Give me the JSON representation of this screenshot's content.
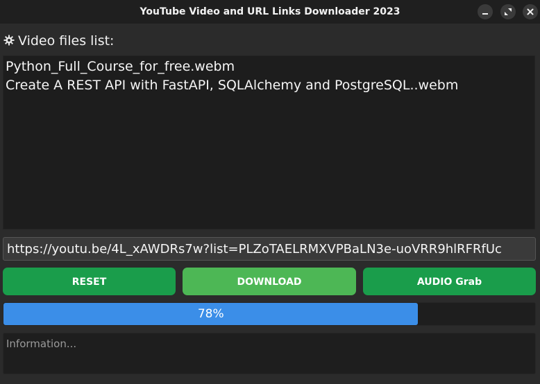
{
  "window": {
    "title": "YouTube Video and URL Links Downloader 2023",
    "controls": [
      "minimize-icon",
      "maximize-icon",
      "close-icon"
    ]
  },
  "file_list": {
    "label": "Video files list:",
    "icon": "gear-icon",
    "items": [
      "Python_Full_Course_for_free.webm",
      "Create A REST API with FastAPI, SQLAlchemy and PostgreSQL..webm"
    ]
  },
  "url_input": {
    "value": "https://youtu.be/4L_xAWDRs7w?list=PLZoTAELRMXVPBaLN3e-uoVRR9hlRFRfUc"
  },
  "buttons": {
    "reset": "RESET",
    "download": "DOWNLOAD",
    "audio": "AUDIO Grab"
  },
  "progress": {
    "value": 0.78,
    "label": "78%",
    "color": "#3b8ee8"
  },
  "info": {
    "placeholder": "Information..."
  },
  "colors": {
    "button_green": "#1a9d4b",
    "button_active": "#4db755",
    "background": "#2b2b2b"
  }
}
